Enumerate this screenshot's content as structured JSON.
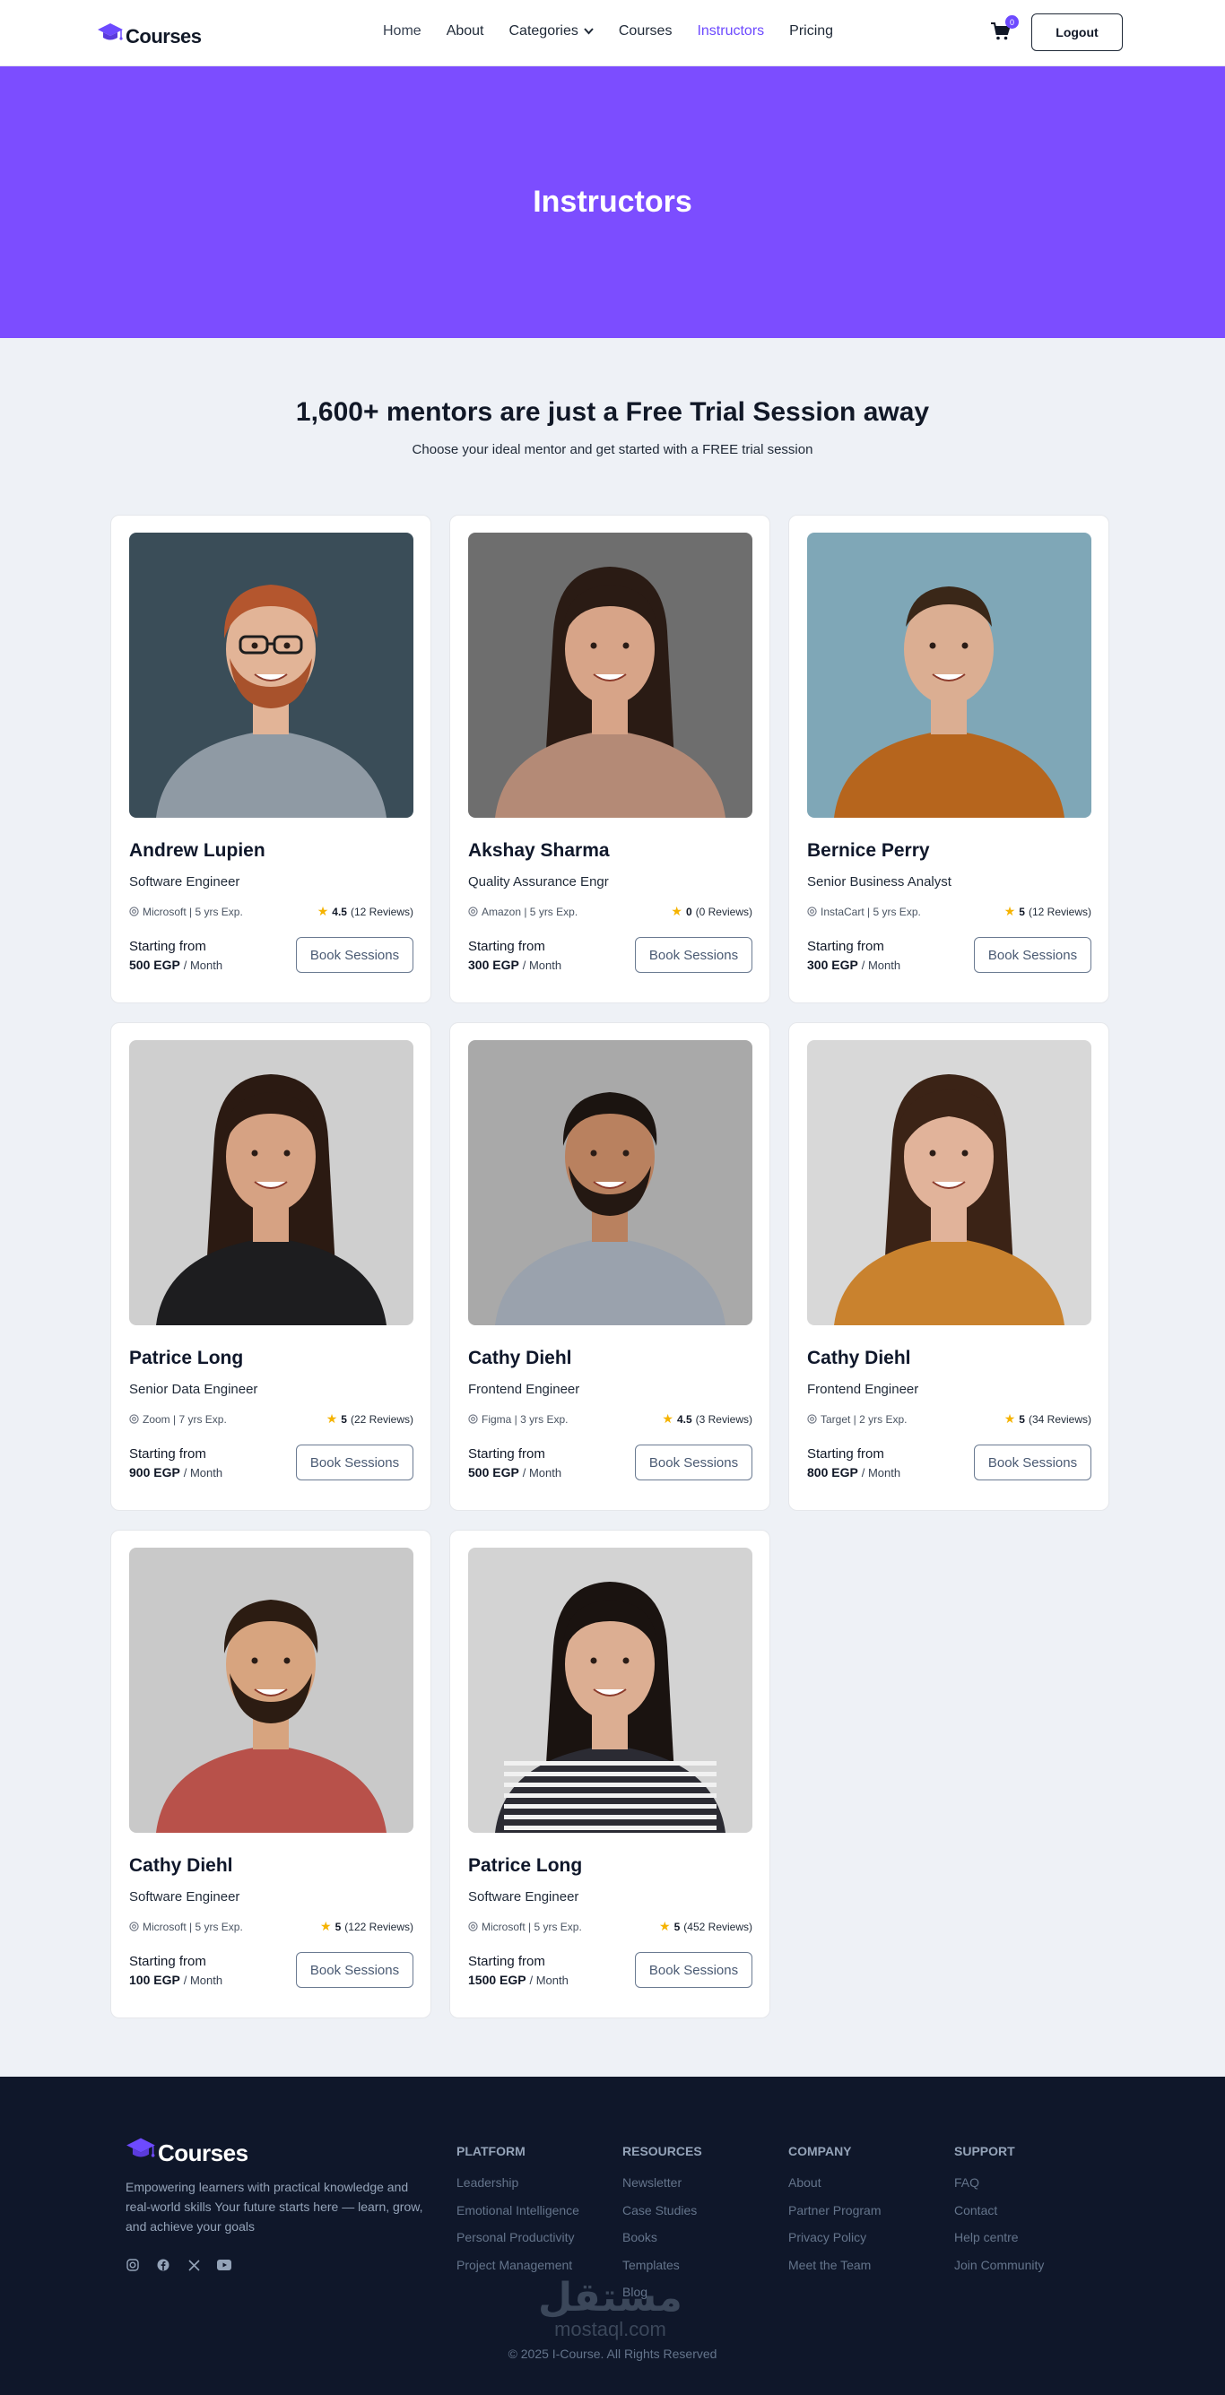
{
  "brand": {
    "name": "Courses"
  },
  "nav": {
    "links": [
      {
        "label": "Home"
      },
      {
        "label": "About"
      },
      {
        "label": "Categories"
      },
      {
        "label": "Courses"
      },
      {
        "label": "Instructors"
      },
      {
        "label": "Pricing"
      }
    ],
    "active": "Instructors",
    "cart_count": "0",
    "logout_label": "Logout"
  },
  "hero": {
    "title": "Instructors"
  },
  "intro": {
    "heading": "1,600+ mentors are just a Free Trial Session away",
    "subheading": "Choose your ideal mentor and get started with a FREE trial session"
  },
  "card_labels": {
    "starting_from": "Starting from",
    "per_month": "/ Month",
    "book": "Book Sessions"
  },
  "instructors": [
    {
      "name": "Andrew Lupien",
      "role": "Software Engineer",
      "company_exp": "Microsoft | 5 yrs Exp.",
      "rating": "4.5",
      "reviews": "(12 Reviews)",
      "price": "500 EGP"
    },
    {
      "name": "Akshay Sharma",
      "role": "Quality Assurance Engr",
      "company_exp": "Amazon | 5 yrs Exp.",
      "rating": "0",
      "reviews": "(0 Reviews)",
      "price": "300 EGP"
    },
    {
      "name": "Bernice Perry",
      "role": "Senior Business Analyst",
      "company_exp": "InstaCart | 5 yrs Exp.",
      "rating": "5",
      "reviews": "(12 Reviews)",
      "price": "300 EGP"
    },
    {
      "name": "Patrice Long",
      "role": "Senior Data Engineer",
      "company_exp": "Zoom | 7 yrs Exp.",
      "rating": "5",
      "reviews": "(22 Reviews)",
      "price": "900 EGP"
    },
    {
      "name": "Cathy Diehl",
      "role": "Frontend Engineer",
      "company_exp": "Figma | 3 yrs Exp.",
      "rating": "4.5",
      "reviews": "(3 Reviews)",
      "price": "500 EGP"
    },
    {
      "name": "Cathy Diehl",
      "role": "Frontend Engineer",
      "company_exp": "Target | 2 yrs Exp.",
      "rating": "5",
      "reviews": "(34 Reviews)",
      "price": "800 EGP"
    },
    {
      "name": "Cathy Diehl",
      "role": "Software Engineer",
      "company_exp": "Microsoft | 5 yrs Exp.",
      "rating": "5",
      "reviews": "(122 Reviews)",
      "price": "100 EGP"
    },
    {
      "name": "Patrice Long",
      "role": "Software Engineer",
      "company_exp": "Microsoft | 5 yrs Exp.",
      "rating": "5",
      "reviews": "(452 Reviews)",
      "price": "1500 EGP"
    }
  ],
  "footer": {
    "tagline": "Empowering learners with practical knowledge and real-world skills Your future starts here — learn, grow, and achieve your goals",
    "socials": [
      "instagram-icon",
      "facebook-icon",
      "x-icon",
      "youtube-icon"
    ],
    "columns": [
      {
        "title": "PLATFORM",
        "items": [
          "Leadership",
          "Emotional Intelligence",
          "Personal Productivity",
          "Project Management"
        ]
      },
      {
        "title": "RESOURCES",
        "items": [
          "Newsletter",
          "Case Studies",
          "Books",
          "Templates",
          "Blog"
        ]
      },
      {
        "title": "COMPANY",
        "items": [
          "About",
          "Partner Program",
          "Privacy Policy",
          "Meet the Team"
        ]
      },
      {
        "title": "SUPPORT",
        "items": [
          "FAQ",
          "Contact",
          "Help centre",
          "Join Community"
        ]
      }
    ],
    "copyright": "© 2025 I-Course. All Rights Reserved",
    "watermark_ar": "مستقل",
    "watermark_en": "mostaql.com"
  },
  "colors": {
    "accent": "#7c4dff",
    "footer_bg": "#0f172a",
    "star": "#f5b301"
  }
}
